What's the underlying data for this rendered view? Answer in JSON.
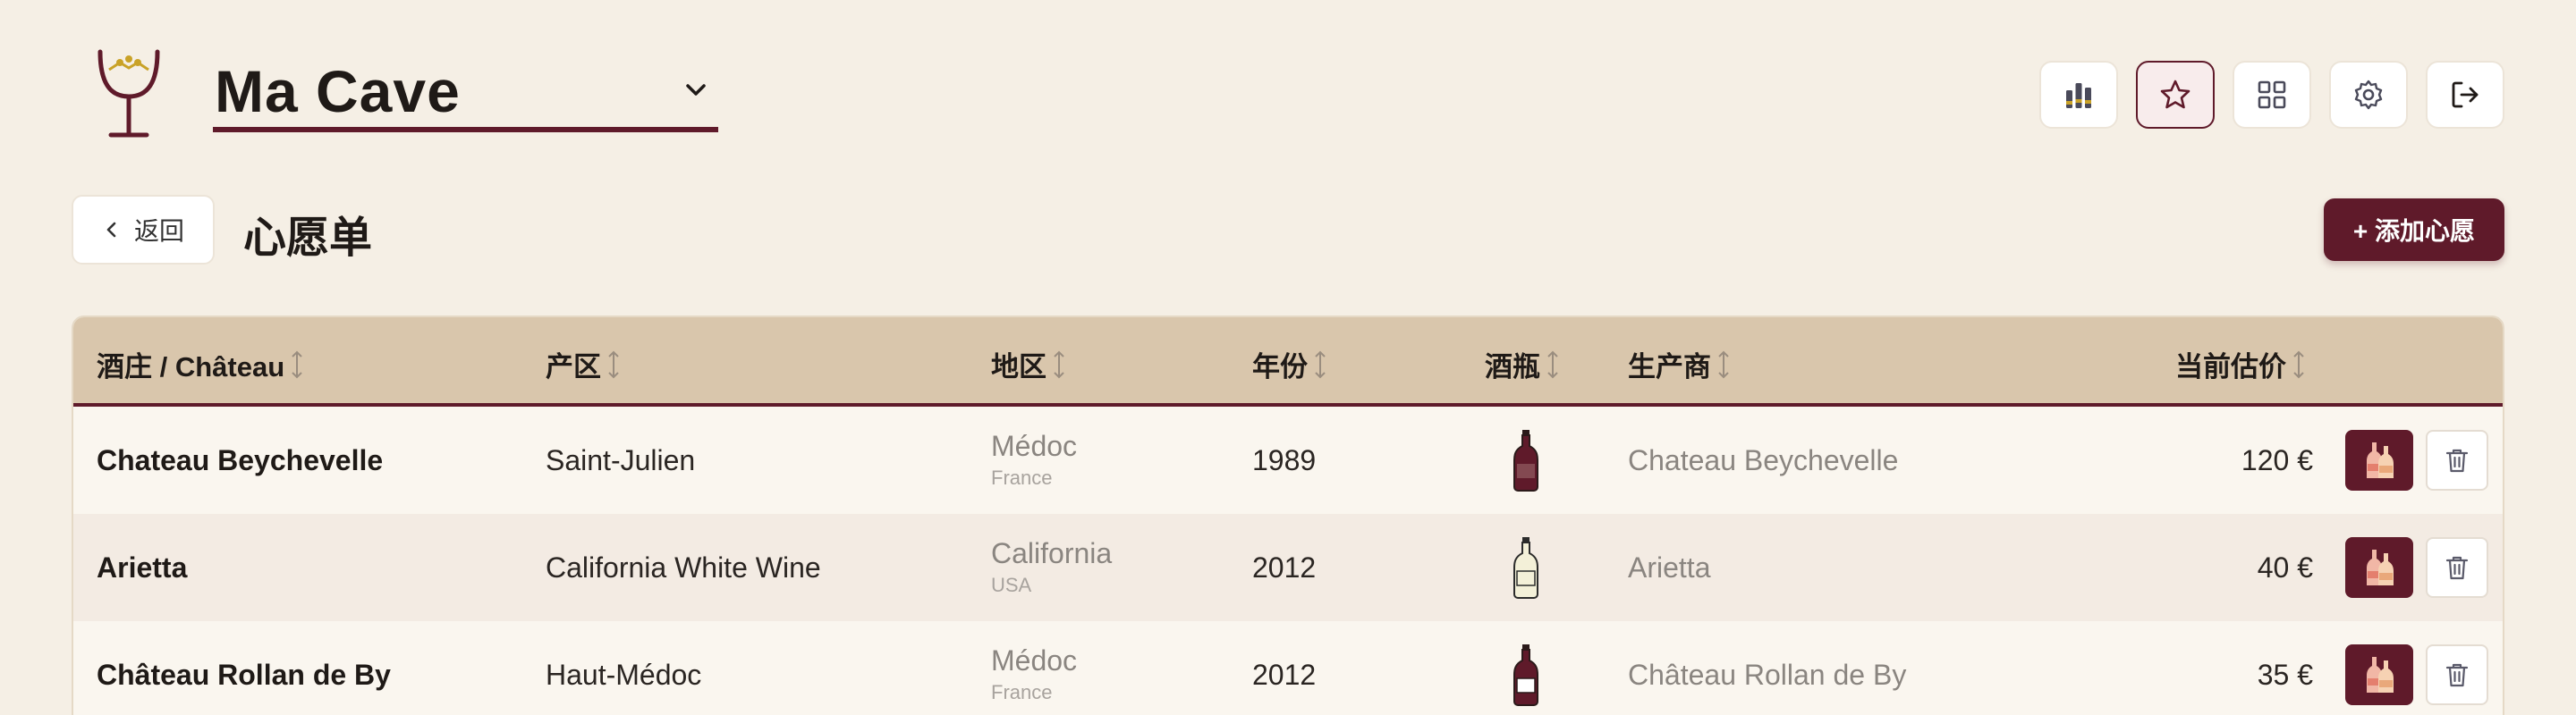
{
  "header": {
    "cellar_name": "Ma Cave",
    "actions": [
      {
        "name": "stats-button",
        "icon": "stats-icon"
      },
      {
        "name": "wishlist-button",
        "icon": "star-icon",
        "active": true
      },
      {
        "name": "grid-view-button",
        "icon": "grid-icon"
      },
      {
        "name": "settings-button",
        "icon": "gear-icon"
      },
      {
        "name": "logout-button",
        "icon": "logout-icon"
      }
    ]
  },
  "subheader": {
    "back_label": "返回",
    "title": "心愿单",
    "add_label": "+ 添加心愿"
  },
  "table": {
    "columns": {
      "name": "酒庄 / Château",
      "appellation": "产区",
      "region": "地区",
      "vintage": "年份",
      "bottle": "酒瓶",
      "producer": "生产商",
      "price": "当前估价"
    },
    "rows": [
      {
        "name": "Chateau Beychevelle",
        "appellation": "Saint-Julien",
        "region": "Médoc",
        "country": "France",
        "vintage": "1989",
        "bottle_type": "red-wine-bottle",
        "producer": "Chateau Beychevelle",
        "price": "120 €"
      },
      {
        "name": "Arietta",
        "appellation": "California White Wine",
        "region": "California",
        "country": "USA",
        "vintage": "2012",
        "bottle_type": "white-wine-bottle",
        "producer": "Arietta",
        "price": "40 €"
      },
      {
        "name": "Château Rollan de By",
        "appellation": "Haut-Médoc",
        "region": "Médoc",
        "country": "France",
        "vintage": "2012",
        "bottle_type": "red-wine-bottle",
        "producer": "Château Rollan de By",
        "price": "35 €"
      }
    ]
  },
  "colors": {
    "background": "#f5efe5",
    "accent": "#5f1a2a",
    "table_header": "#d9c6ac",
    "gold": "#c9a227"
  }
}
